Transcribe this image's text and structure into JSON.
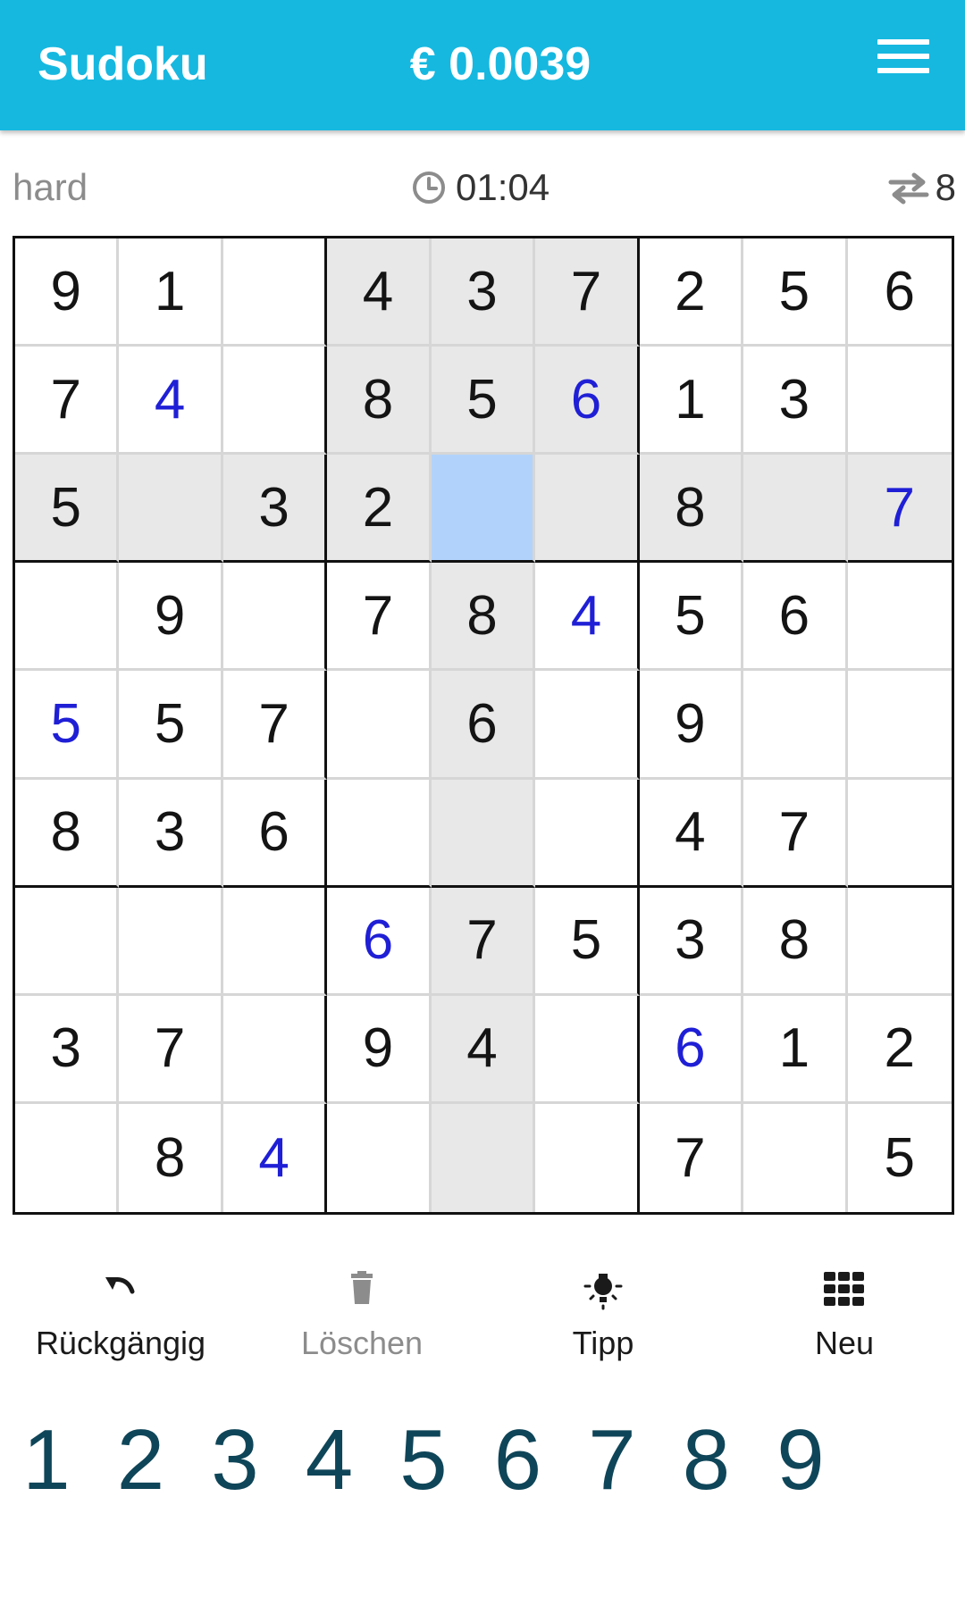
{
  "header": {
    "title": "Sudoku",
    "price": "€ 0.0039"
  },
  "info": {
    "difficulty": "hard",
    "time": "01:04",
    "swaps": "8"
  },
  "grid": [
    [
      {
        "v": "9",
        "u": false
      },
      {
        "v": "1",
        "u": false
      },
      {
        "v": "",
        "u": false
      },
      {
        "v": "4",
        "u": false
      },
      {
        "v": "3",
        "u": false
      },
      {
        "v": "7",
        "u": false
      },
      {
        "v": "2",
        "u": false
      },
      {
        "v": "5",
        "u": false
      },
      {
        "v": "6",
        "u": false
      }
    ],
    [
      {
        "v": "7",
        "u": false
      },
      {
        "v": "4",
        "u": true
      },
      {
        "v": "",
        "u": false
      },
      {
        "v": "8",
        "u": false
      },
      {
        "v": "5",
        "u": false
      },
      {
        "v": "6",
        "u": true
      },
      {
        "v": "1",
        "u": false
      },
      {
        "v": "3",
        "u": false
      },
      {
        "v": "",
        "u": false
      }
    ],
    [
      {
        "v": "5",
        "u": false
      },
      {
        "v": "",
        "u": false
      },
      {
        "v": "3",
        "u": false
      },
      {
        "v": "2",
        "u": false
      },
      {
        "v": "",
        "u": false
      },
      {
        "v": "",
        "u": false
      },
      {
        "v": "8",
        "u": false
      },
      {
        "v": "",
        "u": false
      },
      {
        "v": "7",
        "u": true
      }
    ],
    [
      {
        "v": "",
        "u": false
      },
      {
        "v": "9",
        "u": false
      },
      {
        "v": "",
        "u": false
      },
      {
        "v": "7",
        "u": false
      },
      {
        "v": "8",
        "u": false
      },
      {
        "v": "4",
        "u": true
      },
      {
        "v": "5",
        "u": false
      },
      {
        "v": "6",
        "u": false
      },
      {
        "v": "",
        "u": false
      }
    ],
    [
      {
        "v": "5",
        "u": true
      },
      {
        "v": "5",
        "u": false
      },
      {
        "v": "7",
        "u": false
      },
      {
        "v": "",
        "u": false
      },
      {
        "v": "6",
        "u": false
      },
      {
        "v": "",
        "u": false
      },
      {
        "v": "9",
        "u": false
      },
      {
        "v": "",
        "u": false
      },
      {
        "v": "",
        "u": false
      }
    ],
    [
      {
        "v": "8",
        "u": false
      },
      {
        "v": "3",
        "u": false
      },
      {
        "v": "6",
        "u": false
      },
      {
        "v": "",
        "u": false
      },
      {
        "v": "",
        "u": false
      },
      {
        "v": "",
        "u": false
      },
      {
        "v": "4",
        "u": false
      },
      {
        "v": "7",
        "u": false
      },
      {
        "v": "",
        "u": false
      }
    ],
    [
      {
        "v": "",
        "u": false
      },
      {
        "v": "",
        "u": false
      },
      {
        "v": "",
        "u": false
      },
      {
        "v": "6",
        "u": true
      },
      {
        "v": "7",
        "u": false
      },
      {
        "v": "5",
        "u": false
      },
      {
        "v": "3",
        "u": false
      },
      {
        "v": "8",
        "u": false
      },
      {
        "v": "",
        "u": false
      }
    ],
    [
      {
        "v": "3",
        "u": false
      },
      {
        "v": "7",
        "u": false
      },
      {
        "v": "",
        "u": false
      },
      {
        "v": "9",
        "u": false
      },
      {
        "v": "4",
        "u": false
      },
      {
        "v": "",
        "u": false
      },
      {
        "v": "6",
        "u": true
      },
      {
        "v": "1",
        "u": false
      },
      {
        "v": "2",
        "u": false
      }
    ],
    [
      {
        "v": "",
        "u": false
      },
      {
        "v": "8",
        "u": false
      },
      {
        "v": "4",
        "u": true
      },
      {
        "v": "",
        "u": false
      },
      {
        "v": "",
        "u": false
      },
      {
        "v": "",
        "u": false
      },
      {
        "v": "7",
        "u": false
      },
      {
        "v": "",
        "u": false
      },
      {
        "v": "5",
        "u": false
      }
    ]
  ],
  "selected": {
    "row": 2,
    "col": 4
  },
  "actions": [
    {
      "label": "Rückgängig",
      "icon": "undo-icon",
      "enabled": true
    },
    {
      "label": "Löschen",
      "icon": "trash-icon",
      "enabled": false
    },
    {
      "label": "Tipp",
      "icon": "lightbulb-icon",
      "enabled": true
    },
    {
      "label": "Neu",
      "icon": "grid-icon",
      "enabled": true
    }
  ],
  "numpad": [
    "1",
    "2",
    "3",
    "4",
    "5",
    "6",
    "7",
    "8",
    "9"
  ],
  "colors": {
    "appbar": "#16b8e0",
    "user_digit": "#1f1fd6",
    "highlight": "#e8e8e8",
    "selected": "#b1d3fb",
    "numpad_digit": "#0f4558"
  }
}
